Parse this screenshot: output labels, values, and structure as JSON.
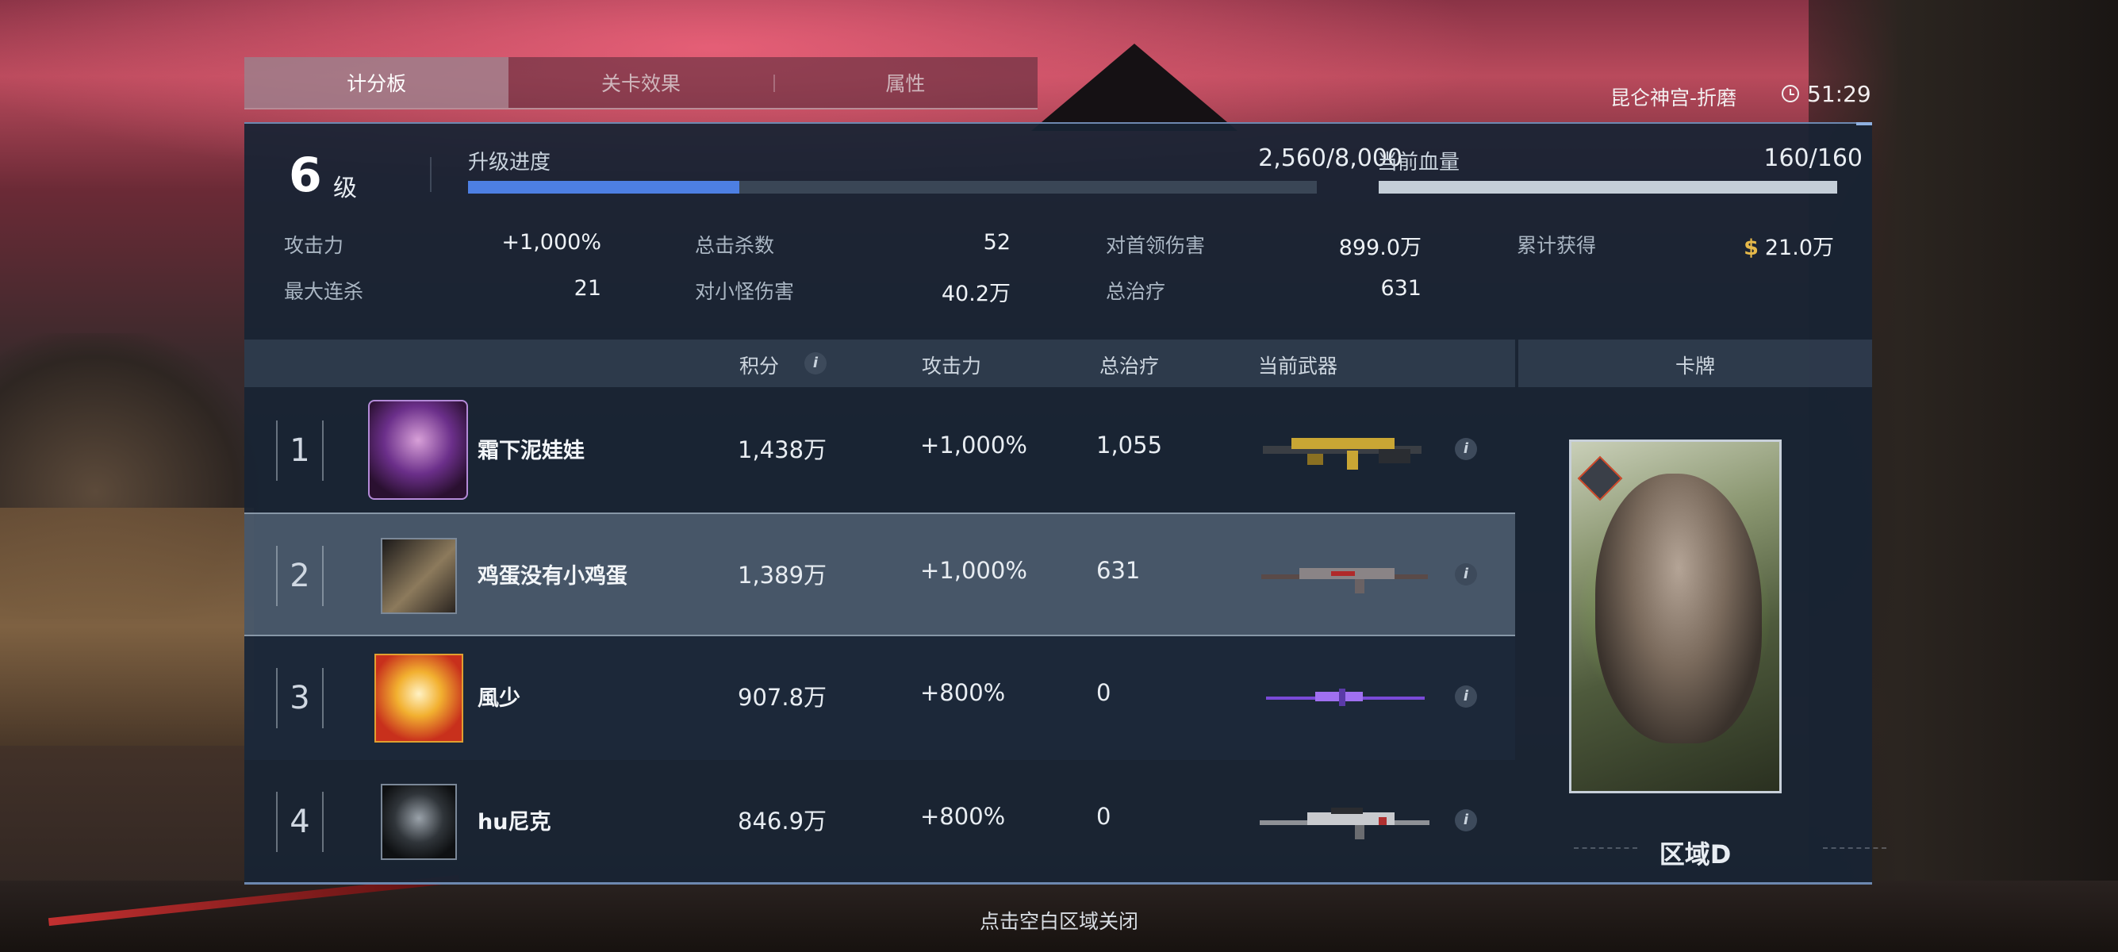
{
  "tabs": [
    {
      "label": "计分板",
      "active": true
    },
    {
      "label": "关卡效果",
      "active": false
    },
    {
      "label": "属性",
      "active": false
    }
  ],
  "location": "昆仑神宫-折磨",
  "timer": "51:29",
  "level": {
    "number": "6",
    "unit": "级"
  },
  "upgrade": {
    "label": "升级进度",
    "value": "2,560/8,000",
    "progress": 0.32
  },
  "health": {
    "label": "当前血量",
    "value": "160/160",
    "progress": 1.0
  },
  "stats": {
    "attack": {
      "label": "攻击力",
      "value": "+1,000%"
    },
    "max_combo": {
      "label": "最大连杀",
      "value": "21"
    },
    "total_kills": {
      "label": "总击杀数",
      "value": "52"
    },
    "minion_damage": {
      "label": "对小怪伤害",
      "value": "40.2万"
    },
    "boss_damage": {
      "label": "对首领伤害",
      "value": "899.0万"
    },
    "total_heal": {
      "label": "总治疗",
      "value": "631"
    },
    "earned": {
      "label": "累计获得",
      "value": "21.0万",
      "currency_symbol": "$"
    }
  },
  "table": {
    "headers": {
      "score": "积分",
      "attack": "攻击力",
      "heal": "总治疗",
      "weapon": "当前武器",
      "card": "卡牌"
    },
    "rows": [
      {
        "rank": "1",
        "name": "霜下泥娃娃",
        "score": "1,438万",
        "attack": "+1,000%",
        "heal": "1,055"
      },
      {
        "rank": "2",
        "name": "鸡蛋没有小鸡蛋",
        "score": "1,389万",
        "attack": "+1,000%",
        "heal": "631"
      },
      {
        "rank": "3",
        "name": "風少",
        "score": "907.8万",
        "attack": "+800%",
        "heal": "0"
      },
      {
        "rank": "4",
        "name": "hu尼克",
        "score": "846.9万",
        "attack": "+800%",
        "heal": "0"
      }
    ]
  },
  "card": {
    "zone": "区域D"
  },
  "close_hint": "点击空白区域关闭",
  "icons": {
    "info": "i",
    "clock": "clock-icon"
  },
  "colors": {
    "progress": "#4d7fe3",
    "health": "#c4ced8",
    "currency": "#e6b94a"
  }
}
